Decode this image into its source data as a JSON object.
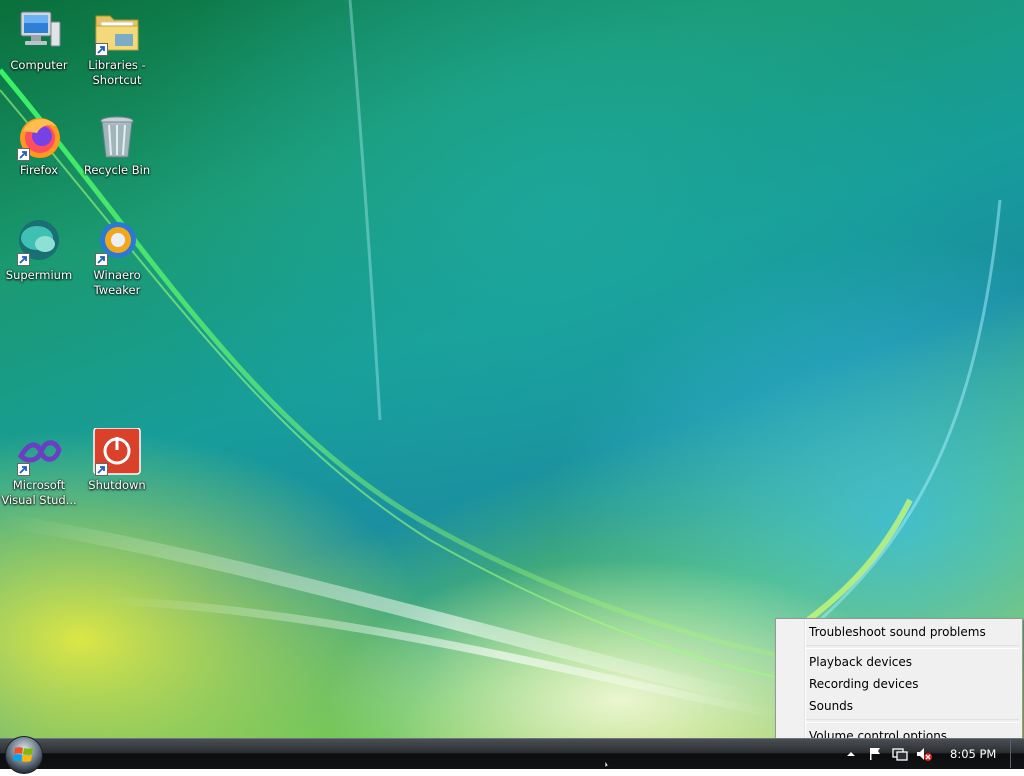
{
  "desktop_icons": [
    {
      "label": "Computer",
      "icon": "computer-icon",
      "shortcut": false
    },
    {
      "label": "Libraries - Shortcut",
      "icon": "folder-icon",
      "shortcut": true
    },
    {
      "label": "Firefox",
      "icon": "firefox-icon",
      "shortcut": true
    },
    {
      "label": "Recycle Bin",
      "icon": "recycle-bin-icon",
      "shortcut": false
    },
    {
      "label": "Supermium",
      "icon": "supermium-icon",
      "shortcut": true
    },
    {
      "label": "Winaero Tweaker",
      "icon": "winaero-tweaker-icon",
      "shortcut": true
    },
    {
      "label": "Microsoft Visual Stud...",
      "icon": "visual-studio-icon",
      "shortcut": true
    },
    {
      "label": "Shutdown",
      "icon": "power-icon",
      "shortcut": true
    }
  ],
  "context_menu": {
    "items": [
      {
        "label": "Troubleshoot sound problems"
      },
      {
        "label": "Playback devices"
      },
      {
        "label": "Recording devices"
      },
      {
        "label": "Sounds"
      },
      {
        "label": "Volume control options"
      }
    ]
  },
  "taskbar": {
    "clock": "8:05 PM",
    "tray_icons": [
      "chevron-up-icon",
      "action-center-flag-icon",
      "network-icon",
      "speaker-muted-icon"
    ]
  },
  "colors": {
    "menu_background": "#f0f0f0",
    "taskbar": "#1c1f22",
    "shutdown_red": "#d9412b"
  }
}
